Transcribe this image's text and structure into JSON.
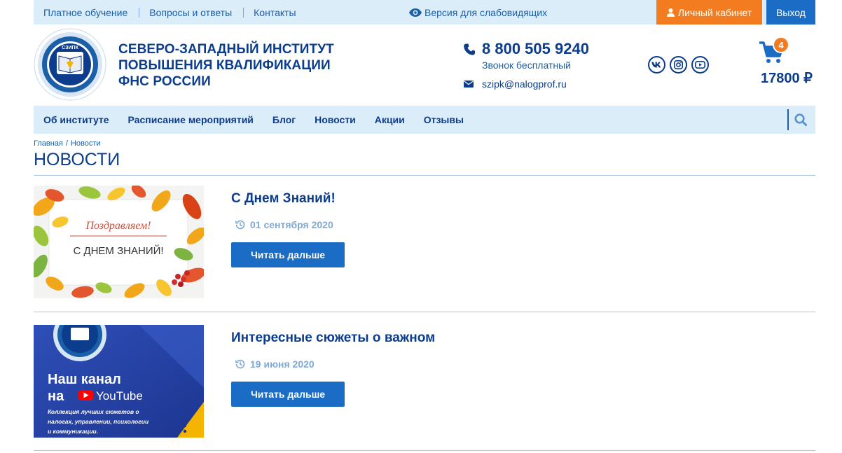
{
  "topbar": {
    "links": [
      "Платное обучение",
      "Вопросы и ответы",
      "Контакты"
    ],
    "vision_label": "Версия для слабовидящих",
    "cabinet_label": "Личный кабинет",
    "logout_label": "Выход",
    "icons": {
      "vision": "eye-icon",
      "cabinet": "user-icon"
    }
  },
  "header": {
    "logo_text": "СЗИПК",
    "org_name": [
      "СЕВЕРО-ЗАПАДНЫЙ ИНСТИТУТ",
      "ПОВЫШЕНИЯ КВАЛИФИКАЦИИ",
      "ФНС РОССИИ"
    ],
    "phone": "8 800 505 9240",
    "phone_note": "Звонок бесплатный",
    "email": "szipk@nalogprof.ru",
    "socials": [
      "vk-icon",
      "instagram-icon",
      "youtube-icon"
    ],
    "cart_count": "4",
    "cart_total": "17800 ₽"
  },
  "nav": {
    "items": [
      "Об институте",
      "Расписание мероприятий",
      "Блог",
      "Новости",
      "Акции",
      "Отзывы"
    ],
    "search_icon": "search-icon"
  },
  "breadcrumb": {
    "home": "Главная",
    "sep": "/",
    "current": "Новости"
  },
  "page": {
    "title": "НОВОСТИ"
  },
  "news": [
    {
      "title": "С Днем Знаний!",
      "date": "01 сентября 2020",
      "button": "Читать дальше",
      "image_text": {
        "line1": "Поздравляем!",
        "line2": "С ДНЕМ ЗНАНИЙ!"
      }
    },
    {
      "title": "Интересные сюжеты о важном",
      "date": "19 июня 2020",
      "button": "Читать дальше",
      "image_text": {
        "line1": "Наш канал",
        "line2": "на",
        "brand": "YouTube",
        "caption": [
          "Коллекция лучших сюжетов о",
          "налогах, управлении, психологии",
          "и коммуникации."
        ]
      }
    }
  ],
  "colors": {
    "brand_blue": "#0b3d8c",
    "link_blue": "#1a5fa8",
    "button_blue": "#1a6cc4",
    "accent_orange": "#f47c20",
    "bar_bg": "#dcedfa"
  }
}
